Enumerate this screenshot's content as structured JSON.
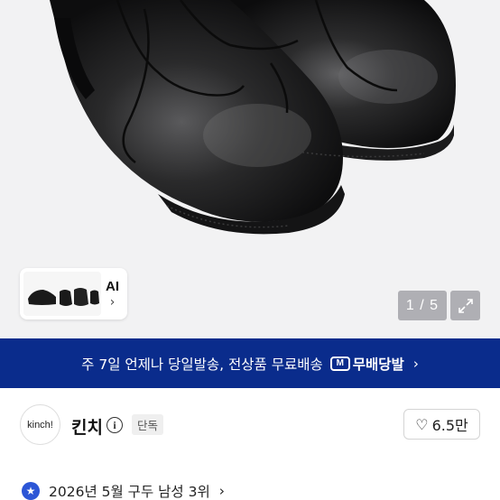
{
  "gallery": {
    "counter": "1 / 5",
    "ai_label": "AI",
    "ai_chevron": "›",
    "icons": {
      "expand": "expand-icon",
      "ai_chevron": "chevron-right-icon"
    }
  },
  "banner": {
    "text": "주 7일 언제나 당일발송, 전상품 무료배송",
    "badge": "M",
    "brand": "무배당발",
    "chevron": "›",
    "background": "#0a2c8c"
  },
  "seller": {
    "avatar_text": "kinch!",
    "name": "킨치",
    "info_glyph": "i",
    "badge": "단독",
    "like_count": "6.5만",
    "like_glyph": "♡"
  },
  "ranking": {
    "text": "2026년 5월 구두 남성 3위",
    "chevron": "›",
    "icon_glyph": "★",
    "accent": "#2c56d6"
  }
}
